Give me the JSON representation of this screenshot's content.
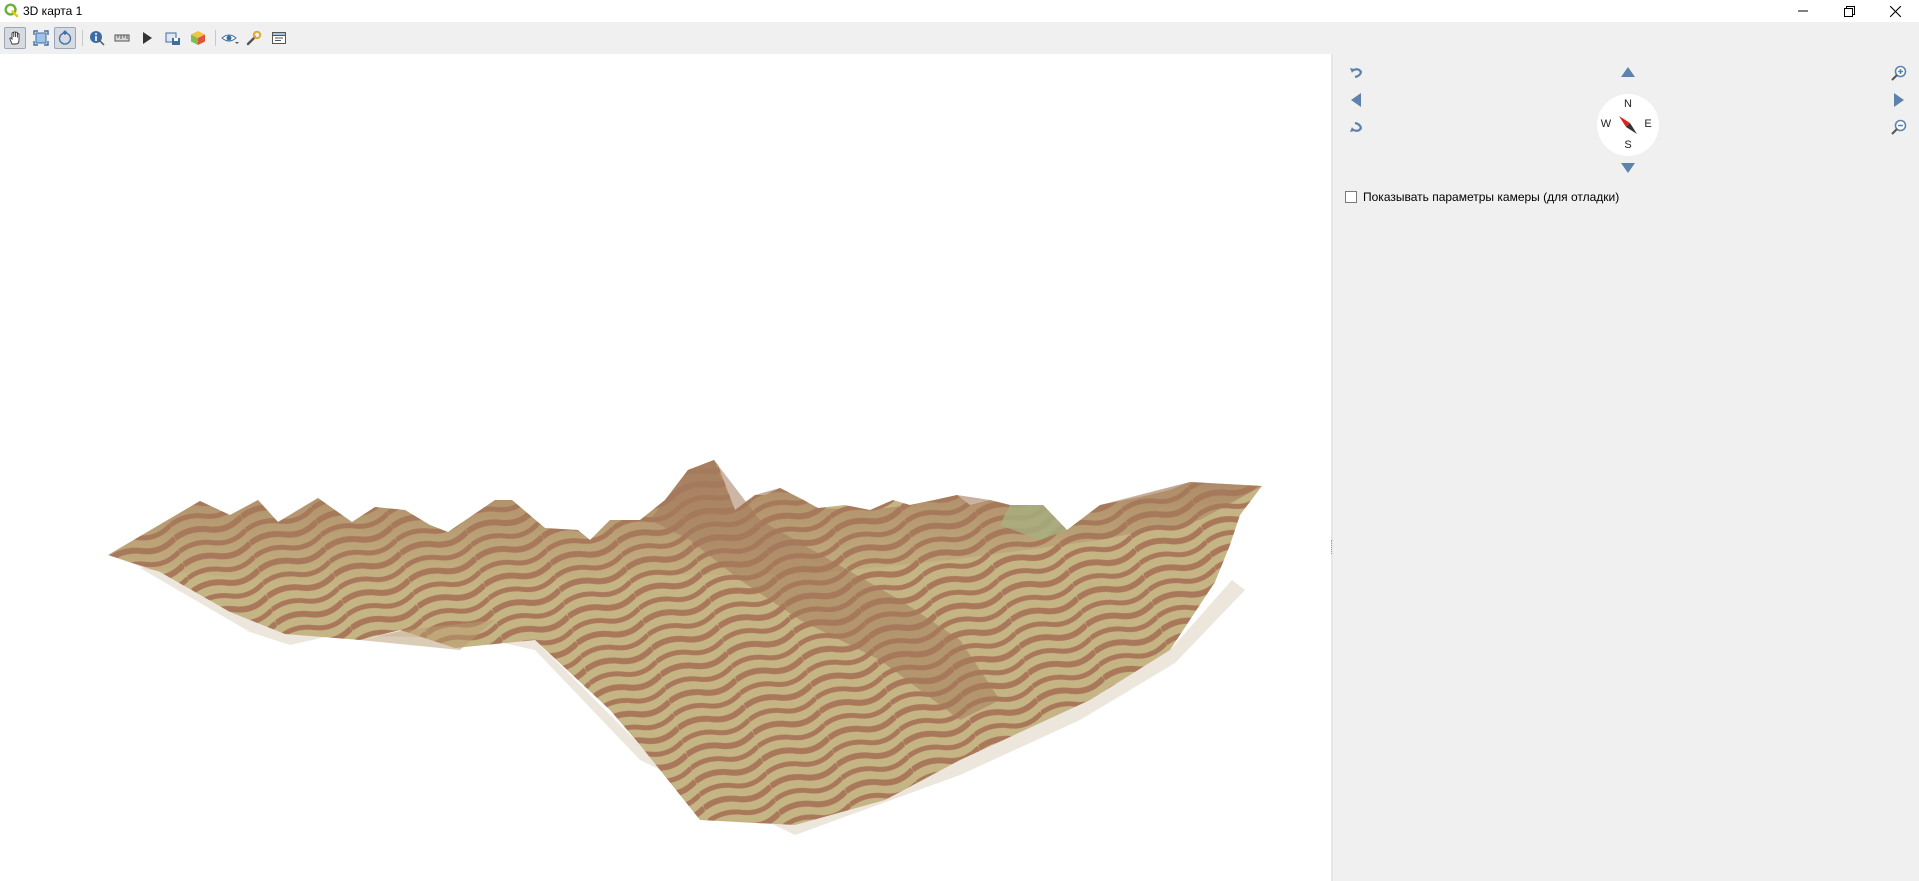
{
  "window": {
    "title": "3D карта 1",
    "app_icon": "qgis-logo-icon",
    "controls": [
      "minimize-icon",
      "restore-icon",
      "close-icon"
    ]
  },
  "toolbar": {
    "buttons": [
      {
        "icon": "pan-hand-icon",
        "active": true
      },
      {
        "icon": "zoom-full-icon",
        "active": false
      },
      {
        "icon": "camera-pivot-icon",
        "active": true
      },
      {
        "icon": "identify-icon",
        "active": false
      },
      {
        "icon": "measure-icon",
        "active": false
      },
      {
        "icon": "animation-play-icon",
        "active": false
      },
      {
        "icon": "save-image-icon",
        "active": false
      },
      {
        "icon": "export-3d-scene-icon",
        "active": false
      },
      {
        "icon": "map-themes-icon",
        "active": false
      },
      {
        "icon": "configure-icon",
        "active": false
      },
      {
        "icon": "options-menu-icon",
        "active": false
      }
    ]
  },
  "navigation": {
    "compass": {
      "n": "N",
      "e": "E",
      "s": "S",
      "w": "W"
    },
    "buttons": [
      "rotate-left-icon",
      "rotate-right-icon",
      "move-up-icon",
      "move-down-icon",
      "move-left-icon",
      "move-right-icon",
      "zoom-in-icon",
      "zoom-out-icon"
    ]
  },
  "debug": {
    "label": "Показывать параметры камеры (для отладки)",
    "checked": false
  },
  "colors": {
    "terrain_brown": "#a9785a",
    "terrain_khaki": "#c9b98a",
    "panel_bg": "#f0f0f0",
    "nav_blue": "#5d83ad",
    "compass_red": "#e02020"
  }
}
